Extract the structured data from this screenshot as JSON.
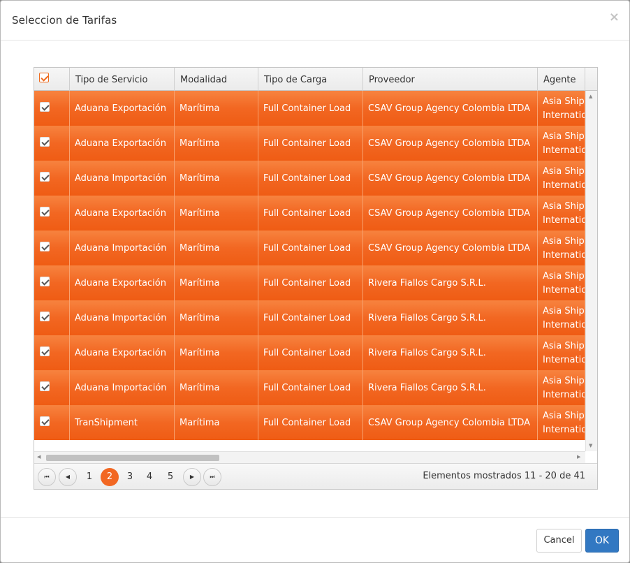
{
  "dialog": {
    "title": "Seleccion de Tarifas",
    "close_glyph": "×"
  },
  "grid": {
    "columns": [
      "Tipo de Servicio",
      "Modalidad",
      "Tipo de Carga",
      "Proveedor",
      "Agente"
    ],
    "rows": [
      {
        "servicio": "Aduana Exportación",
        "modalidad": "Marítima",
        "carga": "Full Container Load",
        "proveedor": "CSAV Group Agency Colombia LTDA",
        "agente_l1": "Asia Shipp",
        "agente_l2": "Internatio"
      },
      {
        "servicio": "Aduana Exportación",
        "modalidad": "Marítima",
        "carga": "Full Container Load",
        "proveedor": "CSAV Group Agency Colombia LTDA",
        "agente_l1": "Asia Shipp",
        "agente_l2": "Internatio"
      },
      {
        "servicio": "Aduana Importación",
        "modalidad": "Marítima",
        "carga": "Full Container Load",
        "proveedor": "CSAV Group Agency Colombia LTDA",
        "agente_l1": "Asia Shipp",
        "agente_l2": "Internatio"
      },
      {
        "servicio": "Aduana Exportación",
        "modalidad": "Marítima",
        "carga": "Full Container Load",
        "proveedor": "CSAV Group Agency Colombia LTDA",
        "agente_l1": "Asia Shipp",
        "agente_l2": "Internatio"
      },
      {
        "servicio": "Aduana Importación",
        "modalidad": "Marítima",
        "carga": "Full Container Load",
        "proveedor": "CSAV Group Agency Colombia LTDA",
        "agente_l1": "Asia Shipp",
        "agente_l2": "Internatio"
      },
      {
        "servicio": "Aduana Exportación",
        "modalidad": "Marítima",
        "carga": "Full Container Load",
        "proveedor": "Rivera Fiallos Cargo S.R.L.",
        "agente_l1": "Asia Shipp",
        "agente_l2": "Internatio"
      },
      {
        "servicio": "Aduana Importación",
        "modalidad": "Marítima",
        "carga": "Full Container Load",
        "proveedor": "Rivera Fiallos Cargo S.R.L.",
        "agente_l1": "Asia Shipp",
        "agente_l2": "Internatio"
      },
      {
        "servicio": "Aduana Exportación",
        "modalidad": "Marítima",
        "carga": "Full Container Load",
        "proveedor": "Rivera Fiallos Cargo S.R.L.",
        "agente_l1": "Asia Shipp",
        "agente_l2": "Internatio"
      },
      {
        "servicio": "Aduana Importación",
        "modalidad": "Marítima",
        "carga": "Full Container Load",
        "proveedor": "Rivera Fiallos Cargo S.R.L.",
        "agente_l1": "Asia Shipp",
        "agente_l2": "Internatio"
      },
      {
        "servicio": "TranShipment",
        "modalidad": "Marítima",
        "carga": "Full Container Load",
        "proveedor": "CSAV Group Agency Colombia LTDA",
        "agente_l1": "Asia Shipp",
        "agente_l2": "Internatio"
      }
    ]
  },
  "pager": {
    "first_glyph": "⏮",
    "prev_glyph": "◀",
    "next_glyph": "▶",
    "last_glyph": "⏭",
    "pages": [
      "1",
      "2",
      "3",
      "4",
      "5"
    ],
    "current_page": "2",
    "info": "Elementos mostrados 11 - 20 de 41"
  },
  "footer": {
    "cancel_label": "Cancel",
    "ok_label": "OK"
  },
  "colors": {
    "row_accent": "#f26722",
    "primary_button": "#3278c2"
  }
}
